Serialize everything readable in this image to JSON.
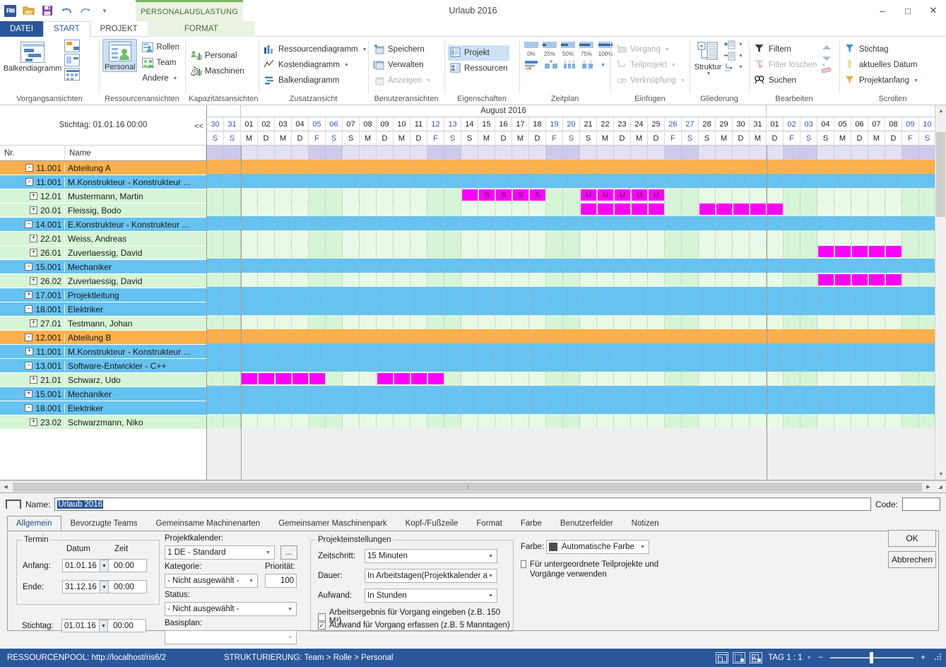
{
  "window": {
    "title": "Urlaub 2016",
    "minimize": "–",
    "maximize": "☐",
    "close": "✕"
  },
  "quick_access": [
    {
      "name": "app-icon",
      "label": "R"
    },
    {
      "name": "open-icon",
      "label": "open"
    },
    {
      "name": "save-icon",
      "label": "save"
    },
    {
      "name": "undo-icon",
      "label": "↶"
    },
    {
      "name": "redo-icon",
      "label": "↷"
    },
    {
      "name": "customize-qat-icon",
      "label": "▾"
    }
  ],
  "context_tab_strip": "PERSONALAUSLASTUNG",
  "ribbon_tabs": [
    {
      "label": "DATEI",
      "state": "file"
    },
    {
      "label": "START",
      "state": "active"
    },
    {
      "label": "PROJEKT",
      "state": "normal"
    },
    {
      "label": "FORMAT",
      "state": "context"
    }
  ],
  "ribbon_groups": [
    {
      "name": "Vorgangsansichten",
      "big": {
        "label": "Balkendiagramm",
        "icon": "gantt-chart-icon",
        "selected": false
      },
      "small_icons": [
        "network-view-icon",
        "form-view-icon",
        "table-view-icon"
      ]
    },
    {
      "name": "Ressourcenansichten",
      "big": {
        "label": "Personal",
        "icon": "personnel-icon",
        "selected": true
      },
      "items": [
        {
          "label": "Rollen",
          "icon": "roles-icon",
          "dropdown": false,
          "disabled": false
        },
        {
          "label": "Team",
          "icon": "team-icon",
          "dropdown": false,
          "disabled": false
        },
        {
          "label": "Andere",
          "icon": "",
          "dropdown": true,
          "disabled": false
        }
      ]
    },
    {
      "name": "Kapazitätsansichten",
      "items": [
        {
          "label": "Personal",
          "icon": "capacity-personnel-icon",
          "dropdown": false,
          "disabled": false
        },
        {
          "label": "Maschinen",
          "icon": "capacity-machines-icon",
          "dropdown": false,
          "disabled": false
        }
      ]
    },
    {
      "name": "Zusatzansicht",
      "items": [
        {
          "label": "Ressourcendiagramm",
          "icon": "bar-chart-icon",
          "dropdown": true,
          "disabled": false
        },
        {
          "label": "Kostendiagramm",
          "icon": "line-chart-icon",
          "dropdown": true,
          "disabled": false
        },
        {
          "label": "Balkendiagramm",
          "icon": "gantt-small-icon",
          "dropdown": false,
          "disabled": false
        }
      ]
    },
    {
      "name": "Benutzeransichten",
      "items": [
        {
          "label": "Speichern",
          "icon": "save-view-icon",
          "dropdown": false,
          "disabled": false
        },
        {
          "label": "Verwalten",
          "icon": "manage-view-icon",
          "dropdown": false,
          "disabled": false
        },
        {
          "label": "Anzeigen",
          "icon": "show-view-icon",
          "dropdown": true,
          "disabled": true
        }
      ]
    },
    {
      "name": "Eigenschaften",
      "items": [
        {
          "label": "Projekt",
          "icon": "project-properties-icon",
          "dropdown": false,
          "disabled": false,
          "selected": true
        },
        {
          "label": "Ressourcen",
          "icon": "resource-properties-icon",
          "dropdown": false,
          "disabled": false
        }
      ]
    },
    {
      "name": "Zeitplan",
      "progress": [
        "0%",
        "25%",
        "50%",
        "75%",
        "100%"
      ],
      "row2_icons": [
        "indent-task-icon",
        "split-task-icon",
        "link-tasks-icon",
        "group-tasks-icon"
      ]
    },
    {
      "name": "Einfügen",
      "items": [
        {
          "label": "Vorgang",
          "icon": "add-task-icon",
          "dropdown": true,
          "disabled": true
        },
        {
          "label": "Teilprojekt",
          "icon": "add-subproject-icon",
          "dropdown": true,
          "disabled": true
        },
        {
          "label": "Verknüpfung",
          "icon": "add-link-icon",
          "dropdown": true,
          "disabled": true
        }
      ]
    },
    {
      "name": "Gliederung",
      "big": {
        "label": "Struktur",
        "icon": "outline-icon",
        "dropdown": true
      },
      "small_icons": [
        "outline-expand-icon",
        "outline-collapse-icon",
        "outline-level-icon"
      ]
    },
    {
      "name": "Bearbeiten",
      "items": [
        {
          "label": "Filtern",
          "icon": "filter-icon",
          "dropdown": false,
          "disabled": false
        },
        {
          "label": "Filter löschen",
          "icon": "clear-filter-icon",
          "dropdown": true,
          "disabled": true
        },
        {
          "label": "Suchen",
          "icon": "search-icon",
          "dropdown": false,
          "disabled": false
        }
      ],
      "side_icons": [
        "scroll-up-icon",
        "scroll-down-icon",
        "eraser-icon"
      ]
    },
    {
      "name": "Scrollen",
      "items": [
        {
          "label": "Stichtag",
          "icon": "deadline-marker-icon",
          "dropdown": false,
          "disabled": false
        },
        {
          "label": "aktuelles Datum",
          "icon": "today-marker-icon",
          "dropdown": false,
          "disabled": false
        },
        {
          "label": "Projektanfang",
          "icon": "project-start-marker-icon",
          "dropdown": true,
          "disabled": false
        }
      ]
    }
  ],
  "gantt": {
    "stichtag_label": "Stichtag: 01.01.16 00:00",
    "collapse_label": "<<",
    "columns": [
      "Nr.",
      "Name"
    ],
    "rows": [
      {
        "nr": "11.001",
        "name": "Abteilung A",
        "type": "dept",
        "indent": 0,
        "toggle": "-"
      },
      {
        "nr": "11.001",
        "name": "M.Konstrukteur - Konstrukteur ...",
        "type": "role",
        "indent": 1,
        "toggle": "-"
      },
      {
        "nr": "12.01",
        "name": "Mustermann, Martin",
        "type": "pers",
        "indent": 2,
        "toggle": "+"
      },
      {
        "nr": "20.01",
        "name": "Fleissig, Bodo",
        "type": "pers",
        "indent": 2,
        "toggle": "+"
      },
      {
        "nr": "14.001",
        "name": "E.Konstrukteur - Konstrukteur ...",
        "type": "role",
        "indent": 1,
        "toggle": "-"
      },
      {
        "nr": "22.01",
        "name": "Weiss, Andreas",
        "type": "pers",
        "indent": 2,
        "toggle": "+"
      },
      {
        "nr": "26.01",
        "name": "Zuverlaessig, David",
        "type": "pers",
        "indent": 2,
        "toggle": "+"
      },
      {
        "nr": "15.001",
        "name": "Mechaniker",
        "type": "role",
        "indent": 1,
        "toggle": "-"
      },
      {
        "nr": "26.02",
        "name": "Zuverlaessig, David",
        "type": "pers",
        "indent": 2,
        "toggle": "+"
      },
      {
        "nr": "17.001",
        "name": "Projektleitung",
        "type": "role",
        "indent": 1,
        "toggle": "+"
      },
      {
        "nr": "18.001",
        "name": "Elektriker",
        "type": "role",
        "indent": 1,
        "toggle": "-"
      },
      {
        "nr": "27.01",
        "name": "Testmann, Johan",
        "type": "pers",
        "indent": 2,
        "toggle": "+"
      },
      {
        "nr": "12.001",
        "name": "Abteilung B",
        "type": "dept",
        "indent": 0,
        "toggle": "-"
      },
      {
        "nr": "11.001",
        "name": "M.Konstrukteur - Konstrukteur ...",
        "type": "role",
        "indent": 1,
        "toggle": "+"
      },
      {
        "nr": "13.001",
        "name": "Software-Entwickler - C++",
        "type": "role",
        "indent": 1,
        "toggle": "-"
      },
      {
        "nr": "21.01",
        "name": "Schwarz, Udo",
        "type": "pers",
        "indent": 2,
        "toggle": "+"
      },
      {
        "nr": "15.001",
        "name": "Mechaniker",
        "type": "role",
        "indent": 1,
        "toggle": "+"
      },
      {
        "nr": "18.001",
        "name": "Elektriker",
        "type": "role",
        "indent": 1,
        "toggle": "-"
      },
      {
        "nr": "23.02",
        "name": "Schwarzmann, Niko",
        "type": "pers",
        "indent": 2,
        "toggle": "+"
      }
    ],
    "timeline": {
      "months": [
        {
          "label": "",
          "span": 2
        },
        {
          "label": "August 2016",
          "span": 31
        },
        {
          "label": "",
          "span": 10
        }
      ],
      "days": [
        "30",
        "31",
        "01",
        "02",
        "03",
        "04",
        "05",
        "06",
        "07",
        "08",
        "09",
        "10",
        "11",
        "12",
        "13",
        "14",
        "15",
        "16",
        "17",
        "18",
        "19",
        "20",
        "21",
        "22",
        "23",
        "24",
        "25",
        "26",
        "27",
        "28",
        "29",
        "30",
        "31",
        "01",
        "02",
        "03",
        "04",
        "05",
        "06",
        "07",
        "08",
        "09",
        "10"
      ],
      "dow": [
        "S",
        "S",
        "M",
        "D",
        "M",
        "D",
        "F",
        "S",
        "S",
        "M",
        "D",
        "M",
        "D",
        "F",
        "S",
        "S",
        "M",
        "D",
        "M",
        "D",
        "F",
        "S",
        "S",
        "M",
        "D",
        "M",
        "D",
        "F",
        "S",
        "S",
        "M",
        "D",
        "M",
        "D",
        "F",
        "S",
        "S",
        "M",
        "D",
        "M",
        "D",
        "F",
        "S"
      ],
      "weekend_index": [
        0,
        1,
        6,
        7,
        13,
        14,
        20,
        21,
        27,
        28,
        34,
        35,
        41,
        42
      ]
    },
    "bars": [
      {
        "row": 2,
        "start": 15,
        "len": 1,
        "labels": [
          ""
        ]
      },
      {
        "row": 2,
        "start": 16,
        "len": 4,
        "labels": [
          "S",
          "S",
          "S",
          "S"
        ]
      },
      {
        "row": 2,
        "start": 22,
        "len": 5,
        "labels": [
          "U",
          "U",
          "U",
          "U",
          "U"
        ]
      },
      {
        "row": 3,
        "start": 22,
        "len": 5,
        "labels": [
          "",
          "",
          "",
          "",
          ""
        ]
      },
      {
        "row": 3,
        "start": 29,
        "len": 5,
        "labels": [
          "",
          "",
          "",
          "",
          ""
        ]
      },
      {
        "row": 6,
        "start": 36,
        "len": 5,
        "labels": [
          "",
          "",
          "",
          "",
          ""
        ]
      },
      {
        "row": 8,
        "start": 36,
        "len": 5,
        "labels": [
          "",
          "",
          "",
          "",
          ""
        ]
      },
      {
        "row": 15,
        "start": 2,
        "len": 5,
        "labels": [
          "",
          "",
          "",
          "",
          ""
        ]
      },
      {
        "row": 15,
        "start": 10,
        "len": 4,
        "labels": [
          "",
          "",
          "",
          ""
        ]
      }
    ]
  },
  "form": {
    "name_label": "Name:",
    "name_value": "Urlaub 2016",
    "code_label": "Code:",
    "code_value": "",
    "tabs": [
      {
        "label": "Allgemein",
        "active": true
      },
      {
        "label": "Bevorzugte Teams",
        "active": false
      },
      {
        "label": "Gemeinsame Machinenarten",
        "active": false
      },
      {
        "label": "Gemeinsamer Maschinenpark",
        "active": false
      },
      {
        "label": "Kopf-/Fußzeile",
        "active": false
      },
      {
        "label": "Format",
        "active": false
      },
      {
        "label": "Farbe",
        "active": false
      },
      {
        "label": "Benutzerfelder",
        "active": false
      },
      {
        "label": "Notizen",
        "active": false
      }
    ],
    "termin": {
      "legend": "Termin",
      "col_datum": "Datum",
      "col_zeit": "Zeit",
      "anfang_label": "Anfang:",
      "anfang_date": "01.01.16",
      "anfang_time": "00:00",
      "ende_label": "Ende:",
      "ende_date": "31.12.16",
      "ende_time": "00:00"
    },
    "stichtag_label": "Stichtag:",
    "stichtag_date": "01.01.16",
    "stichtag_time": "00:00",
    "projektkalender_label": "Projektkalender:",
    "projektkalender_value": "1 DE - Standard",
    "projektkalender_browse": "...",
    "kategorie_label": "Kategorie:",
    "kategorie_value": "- Nicht ausgewählt -",
    "prioritaet_label": "Priorität:",
    "prioritaet_value": "100",
    "status_label": "Status:",
    "status_value": "- Nicht ausgewählt -",
    "basisplan_label": "Basisplan:",
    "basisplan_value": "",
    "projekteinstellungen": {
      "legend": "Projekteinstellungen",
      "zeitschritt_label": "Zeitschritt:",
      "zeitschritt_value": "15 Minuten",
      "dauer_label": "Dauer:",
      "dauer_value": "In Arbeitstagen(Projektkalender abh",
      "aufwand_label": "Aufwand:",
      "aufwand_value": "In Stunden",
      "check1_label": "Arbeitsergebnis für Vorgang eingeben (z.B. 150 M³)",
      "check1_checked": false,
      "check2_label": "Aufwand für Vorgang erfassen (z.B. 5 Manntagen)",
      "check2_checked": true
    },
    "farbe_label": "Farbe:",
    "farbe_value": "Automatische Farbe",
    "farbe_swatch": "#4d4d4d",
    "sub_check_label": "Für untergeordnete Teilprojekte und Vorgänge verwenden",
    "sub_check_checked": false,
    "ok_label": "OK",
    "cancel_label": "Abbrechen"
  },
  "statusbar": {
    "resourcepool": "RESSOURCENPOOL: http://localhost/ris6/2",
    "structuring": "STRUKTURIERUNG: Team > Rolle > Personal",
    "zoom_label": "TAG 1 : 1",
    "zoom_out": "−",
    "zoom_in": "+",
    "view_icons": [
      "split-view-icon",
      "table-view-icon",
      "chart-view-icon"
    ]
  },
  "colors": {
    "accent": "#2b579a",
    "dept_row": "#fbb04b",
    "role_row": "#66c2f0",
    "person_row": "#d6f5d6",
    "bar": "#ff00ff",
    "context_green": "#7bb661"
  }
}
